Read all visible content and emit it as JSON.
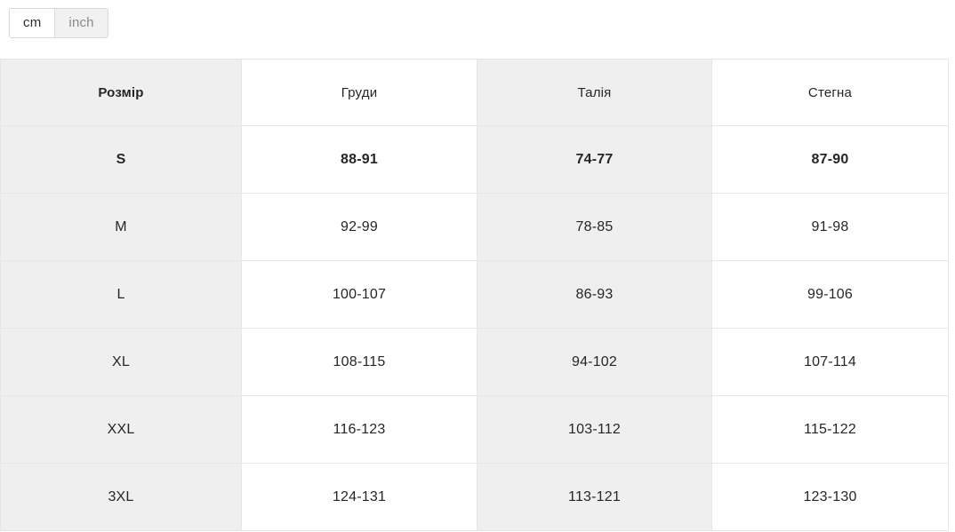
{
  "units": {
    "options": [
      {
        "label": "cm",
        "name": "unit-cm",
        "active": true
      },
      {
        "label": "inch",
        "name": "unit-inch",
        "active": false
      }
    ],
    "selected": "cm"
  },
  "table": {
    "headers": [
      "Розмір",
      "Груди",
      "Талія",
      "Стегна"
    ],
    "rows": [
      {
        "size": "S",
        "chest": "88-91",
        "waist": "74-77",
        "hips": "87-90",
        "highlight": true
      },
      {
        "size": "M",
        "chest": "92-99",
        "waist": "78-85",
        "hips": "91-98",
        "highlight": false
      },
      {
        "size": "L",
        "chest": "100-107",
        "waist": "86-93",
        "hips": "99-106",
        "highlight": false
      },
      {
        "size": "XL",
        "chest": "108-115",
        "waist": "94-102",
        "hips": "107-114",
        "highlight": false
      },
      {
        "size": "XXL",
        "chest": "116-123",
        "waist": "103-112",
        "hips": "115-122",
        "highlight": false
      },
      {
        "size": "3XL",
        "chest": "124-131",
        "waist": "113-121",
        "hips": "123-130",
        "highlight": false
      }
    ]
  },
  "colors": {
    "shaded_cell": "#efefef",
    "plain_cell": "#ffffff",
    "border": "#e6e6e6",
    "text": "#262626",
    "muted_text": "#8a8a8a",
    "toggle_border": "#d8d8d8"
  }
}
